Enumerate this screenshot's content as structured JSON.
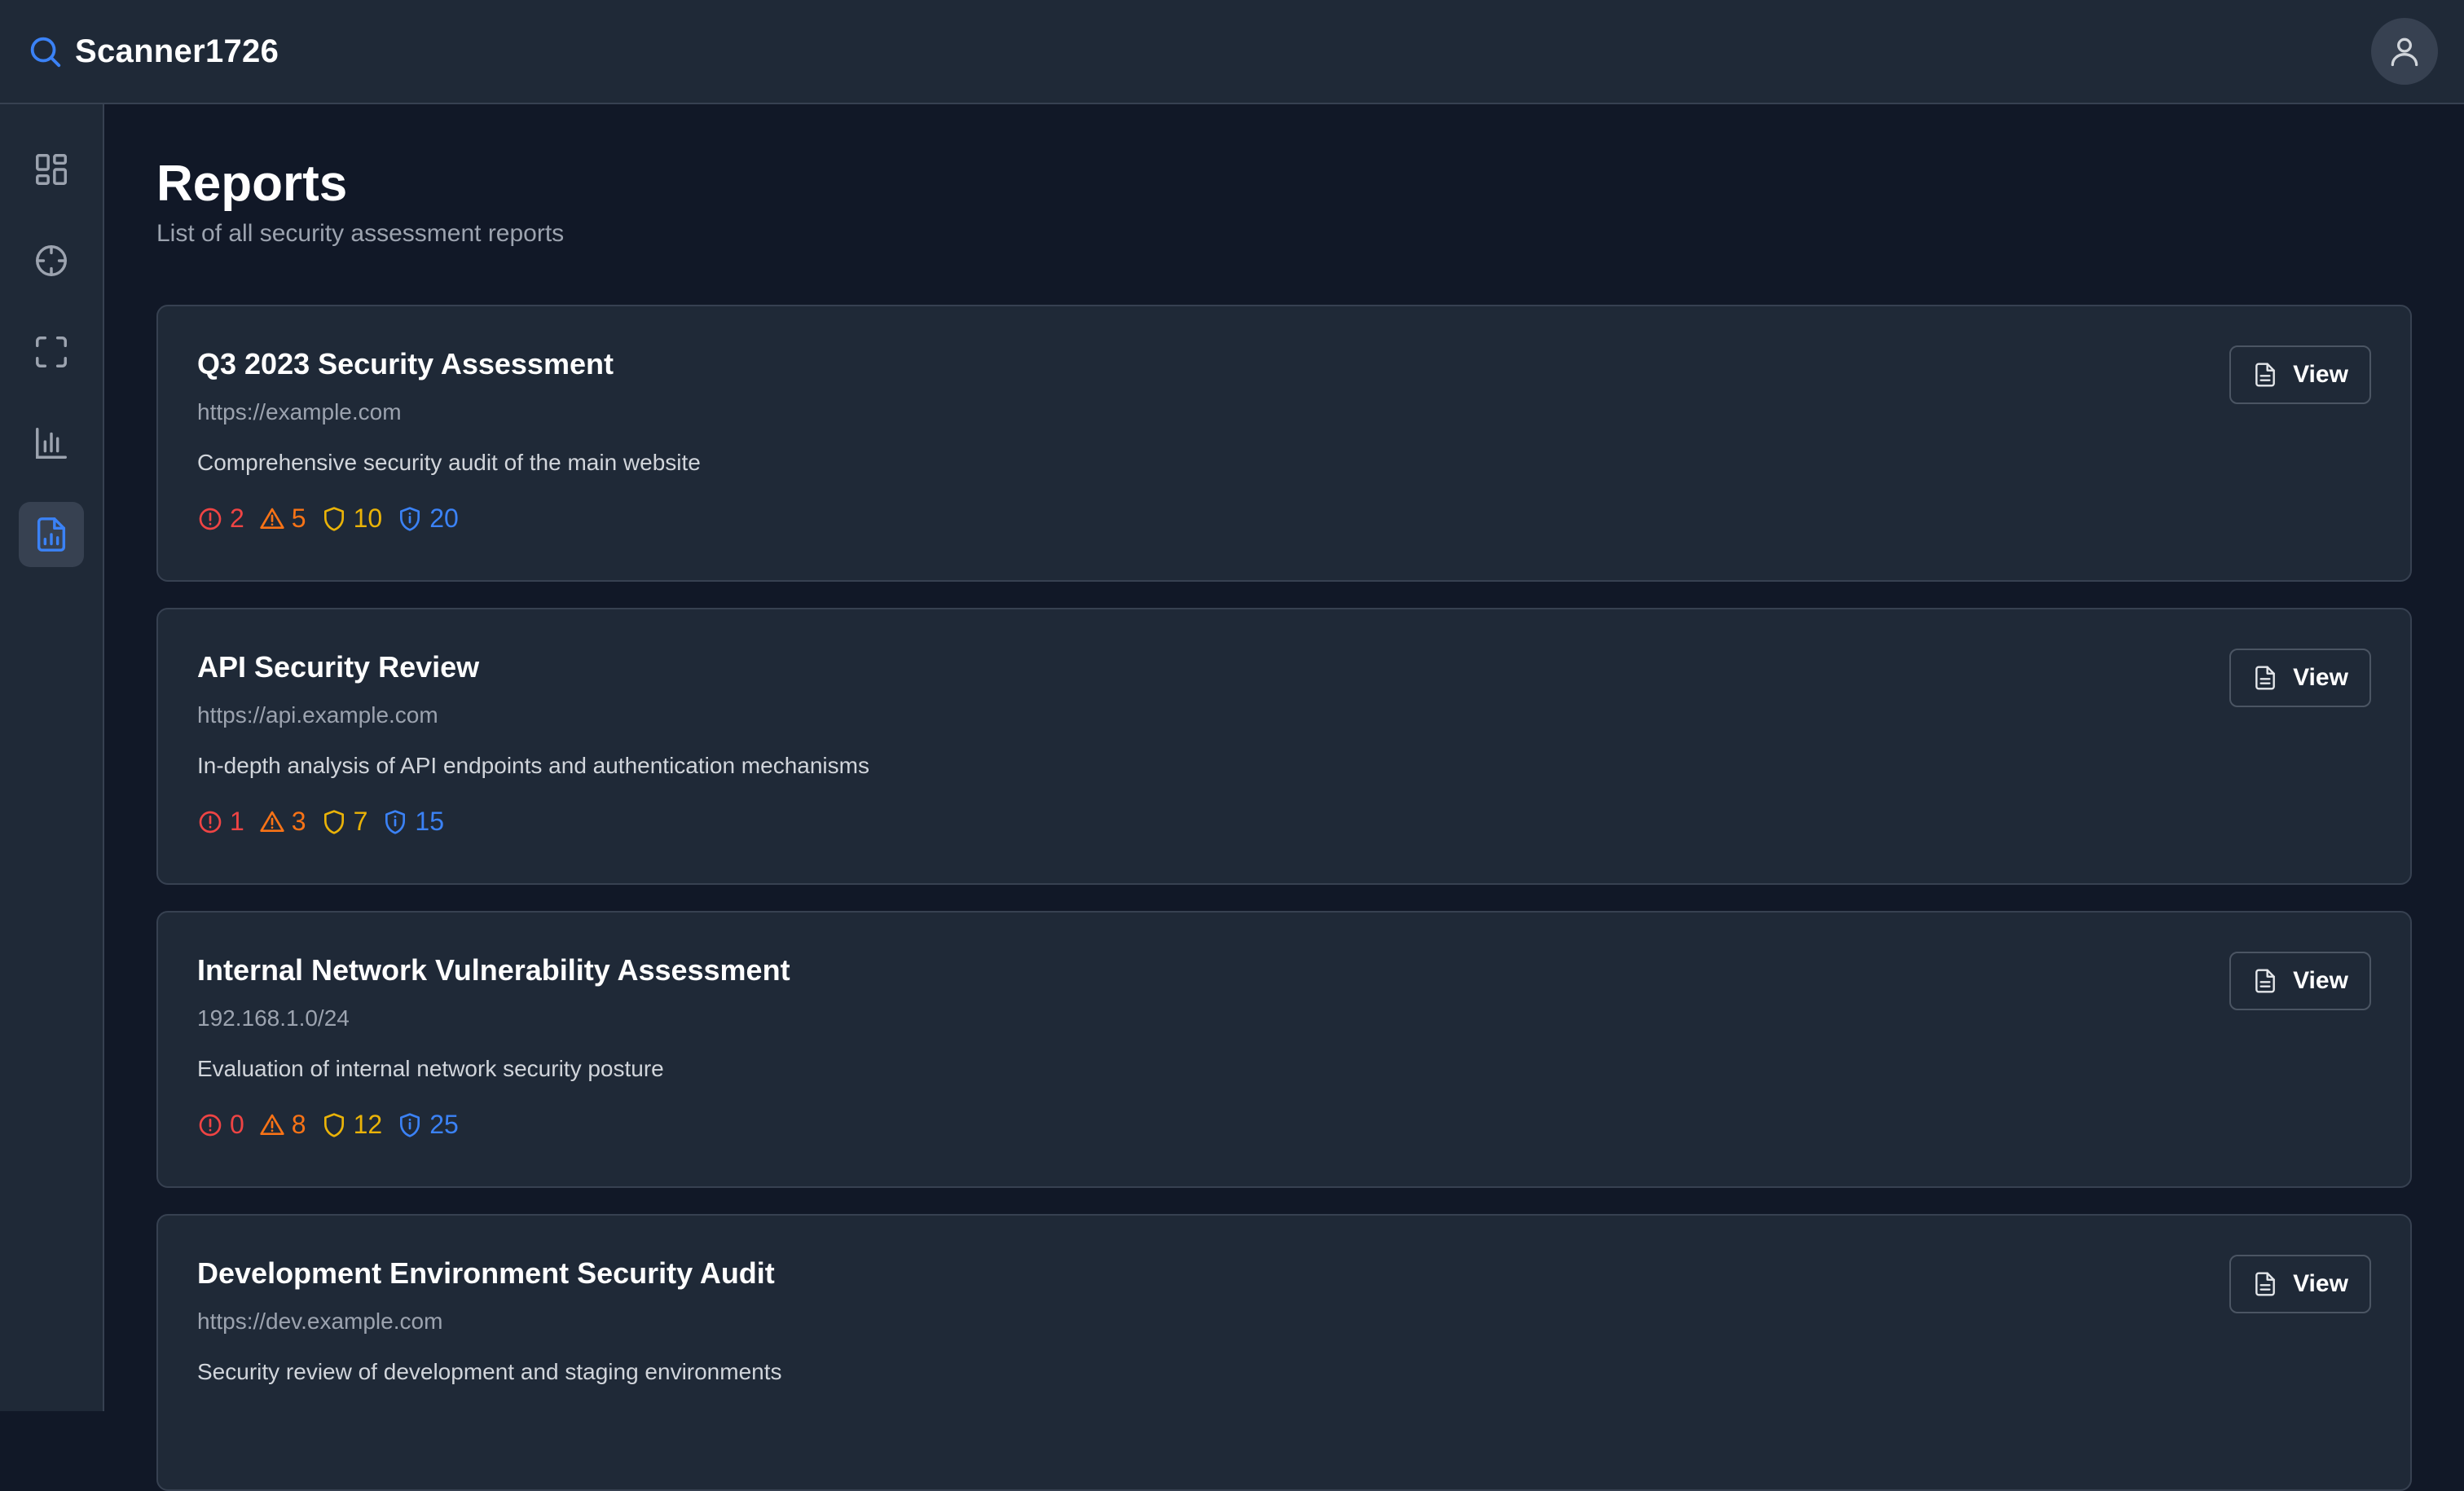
{
  "app": {
    "name": "Scanner1726"
  },
  "icons": {
    "brand": "search-icon",
    "user": "user-icon",
    "nav": [
      "dashboard-icon",
      "target-icon",
      "scan-icon",
      "bar-chart-icon",
      "report-icon"
    ]
  },
  "page": {
    "title": "Reports",
    "subtitle": "List of all security assessment reports"
  },
  "colors": {
    "critical": "#ef4444",
    "high": "#f97316",
    "medium": "#eab308",
    "low": "#3b82f6"
  },
  "view_label": "View",
  "reports": [
    {
      "title": "Q3 2023 Security Assessment",
      "url": "https://example.com",
      "description": "Comprehensive security audit of the main website",
      "critical": "2",
      "high": "5",
      "medium": "10",
      "low": "20"
    },
    {
      "title": "API Security Review",
      "url": "https://api.example.com",
      "description": "In-depth analysis of API endpoints and authentication mechanisms",
      "critical": "1",
      "high": "3",
      "medium": "7",
      "low": "15"
    },
    {
      "title": "Internal Network Vulnerability Assessment",
      "url": "192.168.1.0/24",
      "description": "Evaluation of internal network security posture",
      "critical": "0",
      "high": "8",
      "medium": "12",
      "low": "25"
    },
    {
      "title": "Development Environment Security Audit",
      "url": "https://dev.example.com",
      "description": "Security review of development and staging environments",
      "critical": "",
      "high": "",
      "medium": "",
      "low": ""
    }
  ]
}
